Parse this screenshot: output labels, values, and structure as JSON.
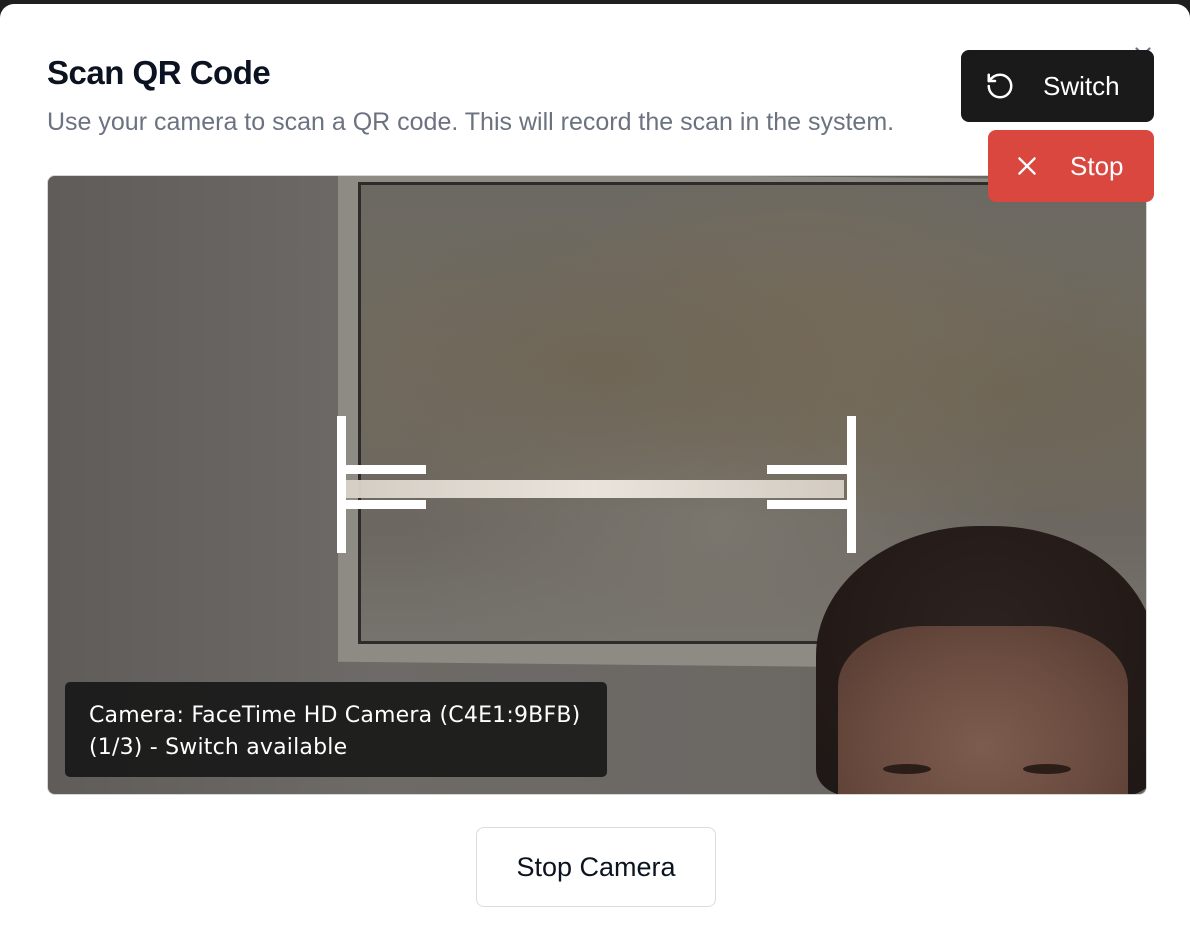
{
  "dialog": {
    "title": "Scan QR Code",
    "subtitle": "Use your camera to scan a QR code. This will record the scan in the system."
  },
  "icons": {
    "close": "close-icon",
    "switch": "rotate-ccw-icon",
    "stop": "x-icon"
  },
  "camera": {
    "label_line1": "Camera: FaceTime HD Camera (C4E1:9BFB)",
    "label_line2": "(1/3) - Switch available"
  },
  "controls": {
    "switch_label": "Switch",
    "stop_label": "Stop",
    "stop_camera_label": "Stop Camera"
  },
  "colors": {
    "switch_bg": "#1a1a1a",
    "stop_bg": "#d9473f",
    "title": "#0b1220",
    "subtitle": "#6b7280"
  }
}
